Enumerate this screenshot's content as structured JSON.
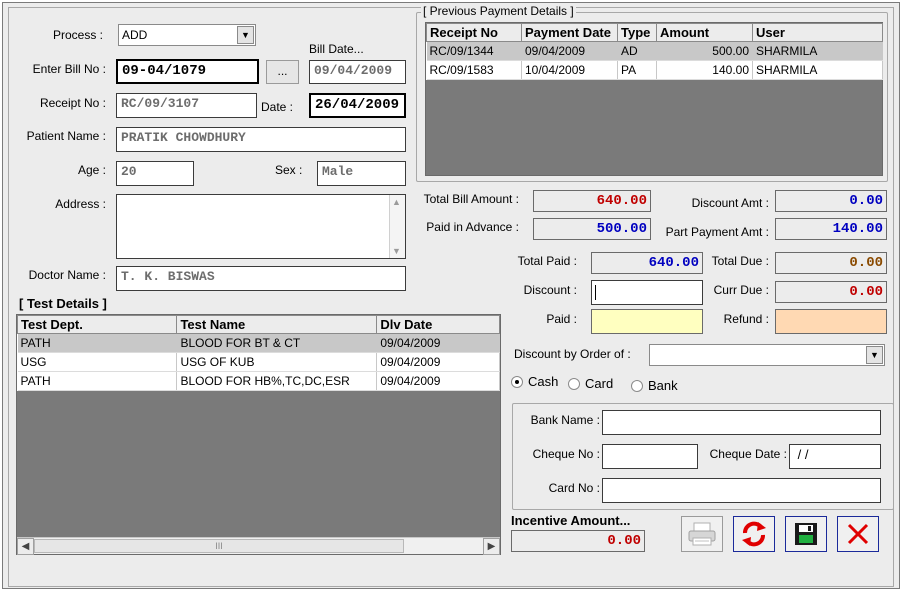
{
  "form": {
    "process_label": "Process :",
    "process_value": "ADD",
    "bill_date_label": "Bill Date...",
    "bill_no_label": "Enter Bill No :",
    "bill_no_value": "09-04/1079",
    "browse_label": "...",
    "bill_date_value": "09/04/2009",
    "receipt_no_label": "Receipt No :",
    "receipt_no_value": "RC/09/3107",
    "date_label": "Date :",
    "date_value": "26/04/2009",
    "patient_name_label": "Patient Name :",
    "patient_name_value": "PRATIK CHOWDHURY",
    "age_label": "Age :",
    "age_value": "20",
    "sex_label": "Sex :",
    "sex_value": "Male",
    "address_label": "Address :",
    "address_value": "",
    "doctor_name_label": "Doctor Name :",
    "doctor_name_value": "T. K. BISWAS"
  },
  "test_details": {
    "title": "[ Test Details ]",
    "columns": [
      "Test Dept.",
      "Test Name",
      "Dlv Date"
    ],
    "rows": [
      {
        "dept": "PATH",
        "name": "BLOOD FOR BT & CT",
        "date": "09/04/2009"
      },
      {
        "dept": "USG",
        "name": "USG OF KUB",
        "date": "09/04/2009"
      },
      {
        "dept": "PATH",
        "name": "BLOOD FOR HB%,TC,DC,ESR",
        "date": "09/04/2009"
      }
    ],
    "scroll_thumb": "III"
  },
  "previous_payments": {
    "title": "[ Previous Payment Details ]",
    "columns": [
      "Receipt No",
      "Payment Date",
      "Type",
      "Amount",
      "User"
    ],
    "rows": [
      {
        "receipt": "RC/09/1344",
        "date": "09/04/2009",
        "type": "AD",
        "amount": "500.00",
        "user": "SHARMILA"
      },
      {
        "receipt": "RC/09/1583",
        "date": "10/04/2009",
        "type": "PA",
        "amount": "140.00",
        "user": "SHARMILA"
      }
    ]
  },
  "amounts": {
    "total_bill_label": "Total Bill Amount :",
    "total_bill_value": "640.00",
    "discount_amt_label": "Discount Amt :",
    "discount_amt_value": "0.00",
    "paid_advance_label": "Paid in Advance :",
    "paid_advance_value": "500.00",
    "part_payment_label": "Part Payment Amt :",
    "part_payment_value": "140.00",
    "total_paid_label": "Total Paid :",
    "total_paid_value": "640.00",
    "total_due_label": "Total Due :",
    "total_due_value": "0.00",
    "discount_label": "Discount :",
    "discount_value": "",
    "curr_due_label": "Curr Due :",
    "curr_due_value": "0.00",
    "paid_label": "Paid :",
    "paid_value": "",
    "refund_label": "Refund :",
    "refund_value": "",
    "discount_order_label": "Discount by Order of :",
    "discount_order_value": ""
  },
  "payment_mode": {
    "cash": "Cash",
    "card": "Card",
    "bank": "Bank",
    "selected": "cash"
  },
  "bank": {
    "bank_name_label": "Bank Name :",
    "bank_name_value": "",
    "cheque_no_label": "Cheque No :",
    "cheque_no_value": "",
    "cheque_date_label": "Cheque Date :",
    "cheque_date_value": " / /",
    "card_no_label": "Card No :",
    "card_no_value": ""
  },
  "incentive": {
    "label": "Incentive Amount...",
    "value": "0.00"
  },
  "colors": {
    "red": "#c00000",
    "blue": "#0000c0",
    "brown": "#8a4a00",
    "paid_bg": "#ffffc0",
    "refund_bg": "#ffd9b3"
  },
  "icons": [
    "printer-icon",
    "refresh-icon",
    "save-icon",
    "close-icon"
  ]
}
